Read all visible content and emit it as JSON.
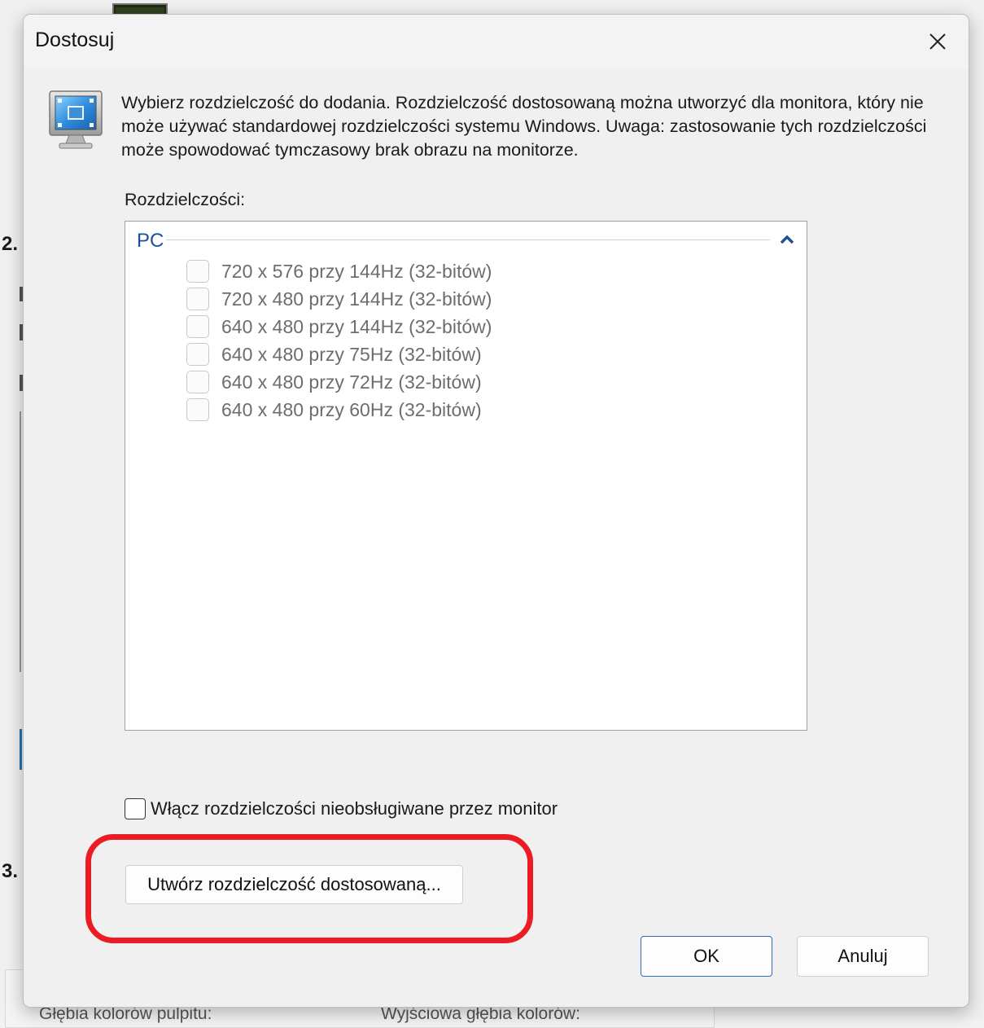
{
  "background": {
    "step_labels": [
      "2.",
      "3."
    ],
    "bottom_labels": [
      "Głębia kolorów pulpitu:",
      "Wyjściowa głębia kolorów:"
    ]
  },
  "dialog": {
    "title": "Dostosuj",
    "close_icon": "close-icon",
    "description": "Wybierz rozdzielczość do dodania. Rozdzielczość dostosowaną można utworzyć dla monitora, który nie może używać standardowej rozdzielczości systemu Windows. Uwaga: zastosowanie tych rozdzielczości może spowodować tymczasowy brak obrazu na monitorze.",
    "resolutions_label": "Rozdzielczości:",
    "group": {
      "title": "PC",
      "collapse_icon": "chevron-up-icon",
      "items": [
        {
          "label": "720 x 576 przy 144Hz (32-bitów)",
          "checked": false,
          "enabled": false
        },
        {
          "label": "720 x 480 przy 144Hz (32-bitów)",
          "checked": false,
          "enabled": false
        },
        {
          "label": "640 x 480 przy 144Hz (32-bitów)",
          "checked": false,
          "enabled": false
        },
        {
          "label": "640 x 480 przy 75Hz (32-bitów)",
          "checked": false,
          "enabled": false
        },
        {
          "label": "640 x 480 przy 72Hz (32-bitów)",
          "checked": false,
          "enabled": false
        },
        {
          "label": "640 x 480 przy 60Hz (32-bitów)",
          "checked": false,
          "enabled": false
        }
      ]
    },
    "enable_unsupported": {
      "label": "Włącz rozdzielczości nieobsługiwane przez monitor",
      "checked": false
    },
    "create_custom_button": "Utwórz rozdzielczość dostosowaną...",
    "ok_button": "OK",
    "cancel_button": "Anuluj"
  },
  "colors": {
    "highlight": "#ec1c24",
    "group_title": "#1f4f9a",
    "ok_border": "#2a6fb7"
  }
}
